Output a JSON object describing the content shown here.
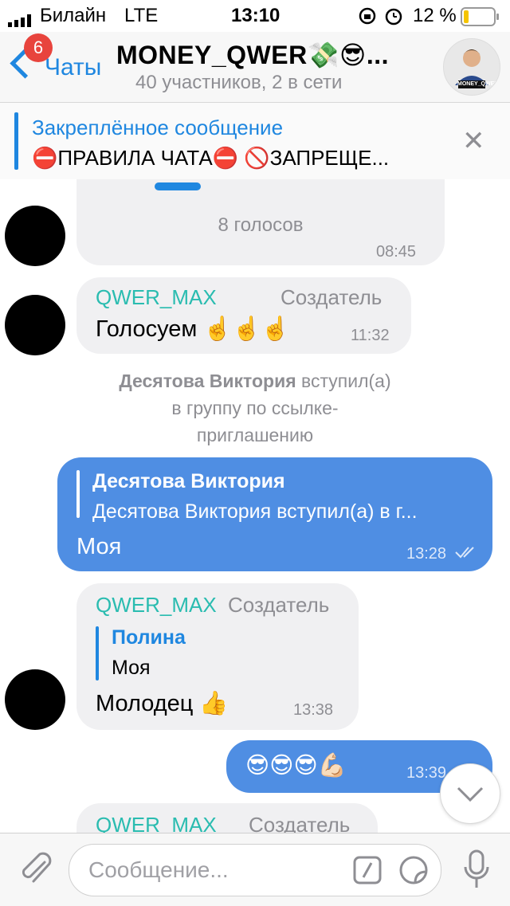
{
  "status_bar": {
    "carrier": "Билайн",
    "network": "LTE",
    "time": "13:10",
    "battery": "12 %"
  },
  "nav": {
    "back_label": "Чаты",
    "badge": "6",
    "title": "MONEY_QWER💸😎...",
    "subtitle": "40 участников, 2 в сети",
    "avatar_text": "MONEY_QWER"
  },
  "pinned": {
    "title": "Закреплённое сообщение",
    "text": "⛔ПРАВИЛА ЧАТА⛔ 🚫ЗАПРЕЩЕ..."
  },
  "messages": {
    "poll": {
      "votes": "8 голосов",
      "time": "08:45"
    },
    "m1": {
      "sender": "QWER_MAX",
      "role": "Создатель",
      "text": "Голосуем ☝️☝️☝️",
      "time": "11:32"
    },
    "system": {
      "name": "Десятова Виктория",
      "action": "вступил(а)",
      "rest1": "в группу по ссылке-",
      "rest2": "приглашению"
    },
    "m2": {
      "reply_name": "Десятова Виктория",
      "reply_text": "Десятова Виктория вступил(а) в г...",
      "text": "Моя",
      "time": "13:28"
    },
    "m3": {
      "sender": "QWER_MAX",
      "role": "Создатель",
      "reply_name": "Полина",
      "reply_text": "Моя",
      "text": "Молодец 👍",
      "time": "13:38"
    },
    "m4": {
      "text": "😎😎😎💪🏻",
      "time": "13:39"
    },
    "m5": {
      "sender": "QWER_MAX",
      "role": "Создатель"
    }
  },
  "input": {
    "placeholder": "Сообщение..."
  },
  "colors": {
    "accent": "#1f87e0",
    "outgoing": "#4f8ee3",
    "sender": "#2abcb0",
    "badge": "#e8443d"
  }
}
